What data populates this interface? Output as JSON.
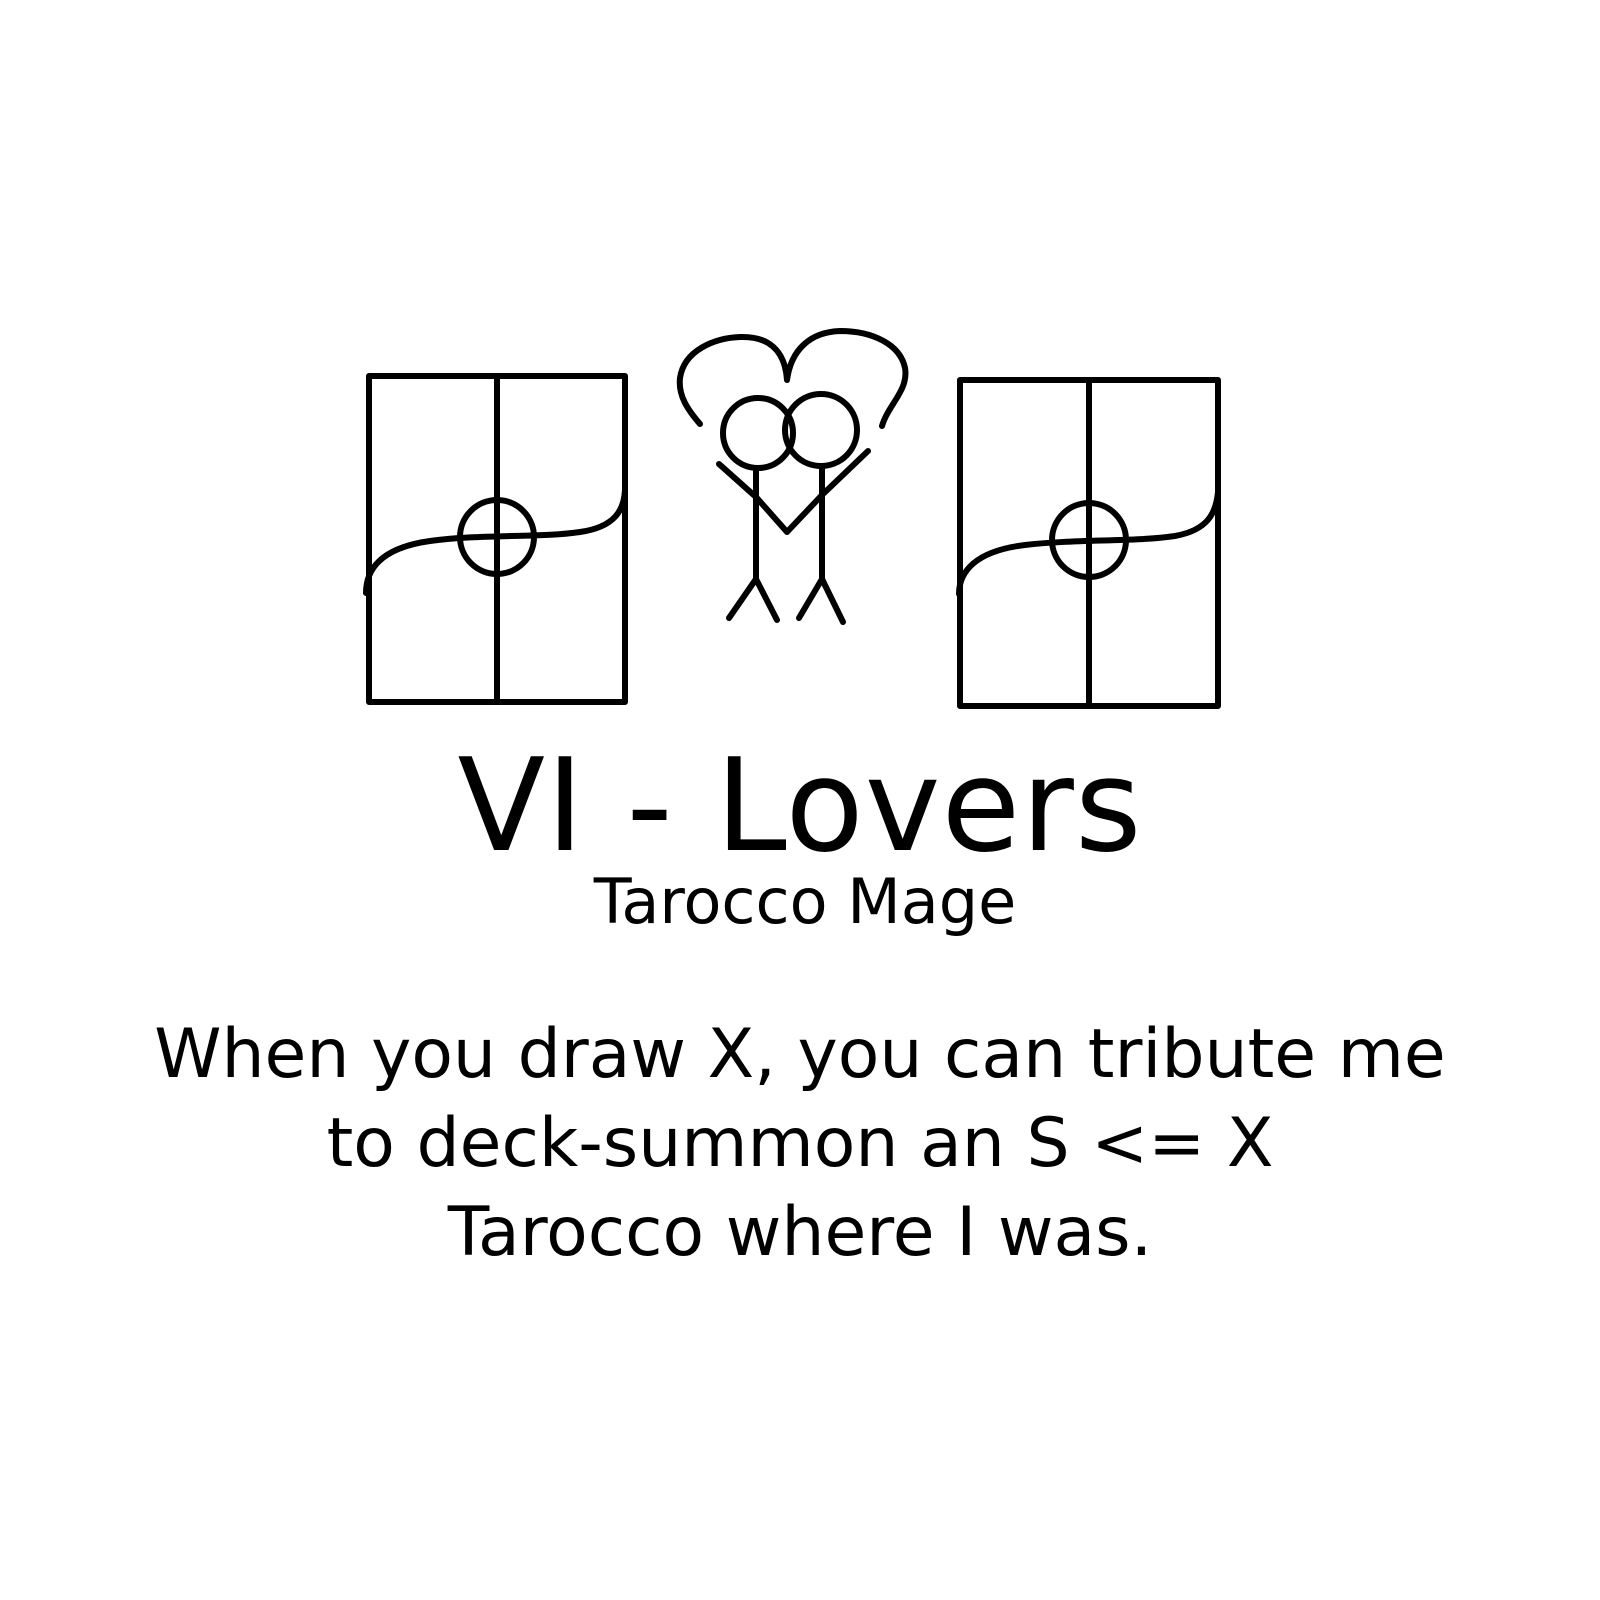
{
  "card": {
    "title": "VI - Lovers",
    "type_line": "Tarocco Mage",
    "ability_lines": [
      "When you draw X, you can tribute me",
      "to deck-summon an S <= X",
      "Tarocco where I was."
    ]
  },
  "art": {
    "left_symbol": "tarocco-card-sigil-icon",
    "center_figure": "lovers-stick-figures-icon",
    "right_symbol": "tarocco-card-sigil-icon",
    "ink_color": "#000000",
    "background_color": "#ffffff"
  }
}
